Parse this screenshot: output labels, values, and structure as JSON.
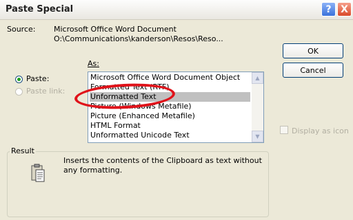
{
  "dialog": {
    "title": "Paste Special",
    "help_label": "?",
    "close_label": "X"
  },
  "source": {
    "label": "Source:",
    "line1": "Microsoft Office Word Document",
    "line2": "O:\\Communications\\kanderson\\Resos\\Reso..."
  },
  "as_label": "As:",
  "options": {
    "paste_label": "Paste:",
    "paste_link_label": "Paste link:",
    "selected": "paste"
  },
  "list": {
    "items": [
      "Microsoft Office Word Document Object",
      "Formatted Text (RTF)",
      "Unformatted Text",
      "Picture (Windows Metafile)",
      "Picture (Enhanced Metafile)",
      "HTML Format",
      "Unformatted Unicode Text"
    ],
    "selected_index": 2
  },
  "buttons": {
    "ok": "OK",
    "cancel": "Cancel"
  },
  "display_as_icon": {
    "label": "Display as icon",
    "checked": false
  },
  "result": {
    "title": "Result",
    "line1": "Inserts the contents of the Clipboard as text without",
    "line2": "any formatting."
  }
}
